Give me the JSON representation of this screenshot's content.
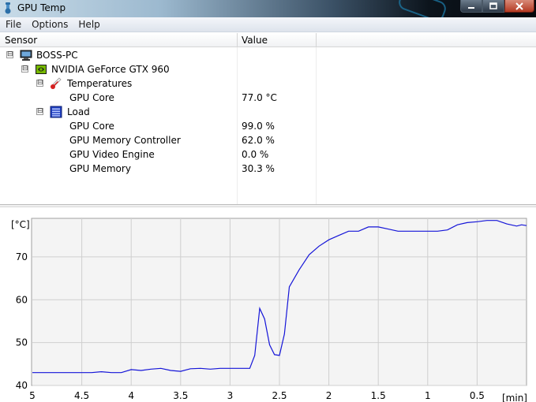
{
  "window": {
    "title": "GPU Temp",
    "controls": [
      "minimize",
      "maximize",
      "close"
    ]
  },
  "menu": {
    "items": [
      "File",
      "Options",
      "Help"
    ]
  },
  "tree": {
    "columns": {
      "sensor": "Sensor",
      "value": "Value"
    },
    "rows": [
      {
        "label": "BOSS-PC",
        "value": "",
        "depth": 0,
        "expander": "⊟",
        "icon": "computer-icon"
      },
      {
        "label": "NVIDIA GeForce GTX 960",
        "value": "",
        "depth": 1,
        "expander": "⊟",
        "icon": "nvidia-gpu-icon"
      },
      {
        "label": "Temperatures",
        "value": "",
        "depth": 2,
        "expander": "⊟",
        "icon": "thermometer-icon"
      },
      {
        "label": "GPU Core",
        "value": "77.0 °C",
        "depth": 3,
        "expander": "",
        "icon": ""
      },
      {
        "label": "Load",
        "value": "",
        "depth": 2,
        "expander": "⊟",
        "icon": "load-icon"
      },
      {
        "label": "GPU Core",
        "value": "99.0 %",
        "depth": 3,
        "expander": "",
        "icon": ""
      },
      {
        "label": "GPU Memory Controller",
        "value": "62.0 %",
        "depth": 3,
        "expander": "",
        "icon": ""
      },
      {
        "label": "GPU Video Engine",
        "value": "0.0 %",
        "depth": 3,
        "expander": "",
        "icon": ""
      },
      {
        "label": "GPU Memory",
        "value": "30.3 %",
        "depth": 3,
        "expander": "",
        "icon": ""
      }
    ]
  },
  "colors": {
    "line": "#1515d8",
    "plot_bg": "#f4f4f4",
    "grid": "#cfcfcf"
  },
  "chart_data": {
    "type": "line",
    "title": "",
    "xlabel": "[min]",
    "ylabel": "[°C]",
    "xlim": [
      5,
      0
    ],
    "ylim": [
      40,
      79
    ],
    "x_ticks": [
      "5",
      "4.5",
      "4",
      "3.5",
      "3",
      "2.5",
      "2",
      "1.5",
      "1",
      "0.5"
    ],
    "y_ticks": [
      "40",
      "50",
      "60",
      "70"
    ],
    "grid": true,
    "series": [
      {
        "x": [
          5,
          4.8,
          4.6,
          4.4,
          4.3,
          4.2,
          4.1,
          4.0,
          3.9,
          3.8,
          3.7,
          3.6,
          3.5,
          3.4,
          3.3,
          3.2,
          3.1,
          3.0,
          2.9,
          2.85,
          2.8,
          2.75,
          2.7,
          2.65,
          2.6,
          2.55,
          2.5,
          2.45,
          2.4,
          2.3,
          2.2,
          2.1,
          2.0,
          1.9,
          1.8,
          1.7,
          1.6,
          1.55,
          1.5,
          1.4,
          1.3,
          1.2,
          1.1,
          1.0,
          0.9,
          0.8,
          0.7,
          0.6,
          0.5,
          0.4,
          0.3,
          0.2,
          0.1,
          0.05,
          0.0
        ],
        "y": [
          43,
          43,
          43,
          43,
          43.2,
          43,
          43,
          43.7,
          43.5,
          43.8,
          44,
          43.5,
          43.3,
          43.9,
          44,
          43.8,
          44,
          44,
          44,
          44,
          44,
          47,
          58,
          55.5,
          49.5,
          47.2,
          47,
          52,
          63,
          67,
          70.5,
          72.5,
          74,
          75,
          76,
          76,
          77,
          77,
          77,
          76.5,
          76,
          76,
          76,
          76,
          76,
          76.3,
          77.5,
          78,
          78.2,
          78.5,
          78.5,
          77.7,
          77.2,
          77.5,
          77.3
        ]
      }
    ]
  }
}
